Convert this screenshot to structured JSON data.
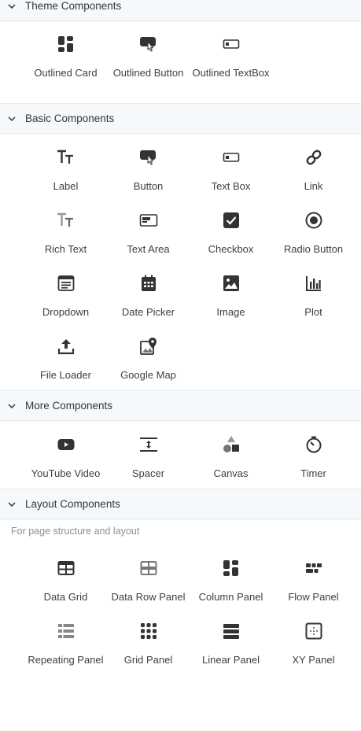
{
  "sections": {
    "theme": {
      "title": "Theme Components"
    },
    "basic": {
      "title": "Basic Components"
    },
    "more": {
      "title": "More Components"
    },
    "layout": {
      "title": "Layout Components",
      "hint": "For page structure and layout"
    }
  },
  "theme_items": [
    {
      "label": "Outlined Card",
      "icon": "dashboard-icon"
    },
    {
      "label": "Outlined Button",
      "icon": "button-click-icon"
    },
    {
      "label": "Outlined TextBox",
      "icon": "textbox-icon"
    }
  ],
  "basic_items": [
    {
      "label": "Label",
      "icon": "text-size-icon"
    },
    {
      "label": "Button",
      "icon": "button-click-icon"
    },
    {
      "label": "Text Box",
      "icon": "textbox-icon"
    },
    {
      "label": "Link",
      "icon": "link-icon"
    },
    {
      "label": "Rich Text",
      "icon": "text-size-icon"
    },
    {
      "label": "Text Area",
      "icon": "text-area-icon"
    },
    {
      "label": "Checkbox",
      "icon": "checkbox-icon"
    },
    {
      "label": "Radio Button",
      "icon": "radio-button-icon"
    },
    {
      "label": "Dropdown",
      "icon": "dropdown-icon"
    },
    {
      "label": "Date Picker",
      "icon": "calendar-icon"
    },
    {
      "label": "Image",
      "icon": "image-icon"
    },
    {
      "label": "Plot",
      "icon": "bar-chart-icon"
    },
    {
      "label": "File Loader",
      "icon": "upload-icon"
    },
    {
      "label": "Google Map",
      "icon": "map-pin-icon"
    }
  ],
  "more_items": [
    {
      "label": "YouTube Video",
      "icon": "youtube-icon"
    },
    {
      "label": "Spacer",
      "icon": "spacer-icon"
    },
    {
      "label": "Canvas",
      "icon": "shapes-icon"
    },
    {
      "label": "Timer",
      "icon": "timer-icon"
    }
  ],
  "layout_items": [
    {
      "label": "Data Grid",
      "icon": "table-icon"
    },
    {
      "label": "Data Row Panel",
      "icon": "data-row-icon"
    },
    {
      "label": "Column Panel",
      "icon": "column-panel-icon"
    },
    {
      "label": "Flow Panel",
      "icon": "flow-panel-icon"
    },
    {
      "label": "Repeating Panel",
      "icon": "list-icon"
    },
    {
      "label": "Grid Panel",
      "icon": "grid-dots-icon"
    },
    {
      "label": "Linear Panel",
      "icon": "stacked-bars-icon"
    },
    {
      "label": "XY Panel",
      "icon": "xy-panel-icon"
    }
  ]
}
